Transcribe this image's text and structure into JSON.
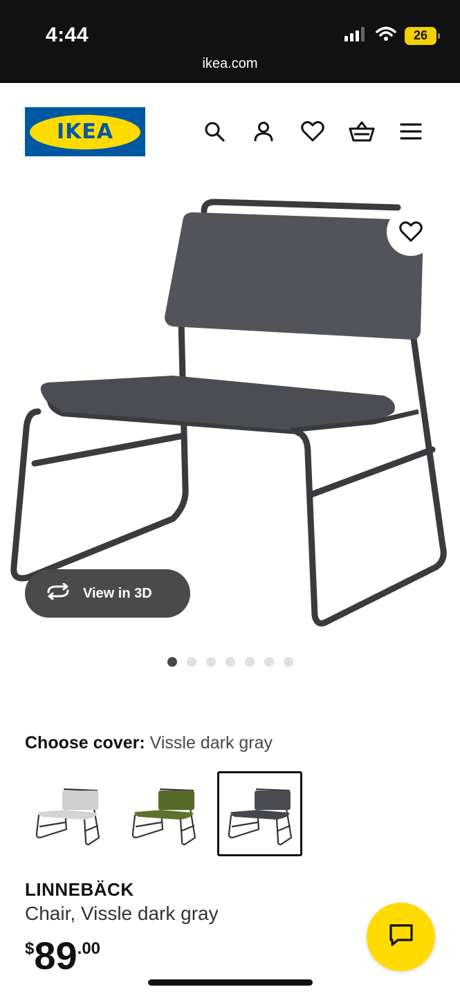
{
  "status_bar": {
    "time": "4:44",
    "battery": "26",
    "url": "ikea.com"
  },
  "header": {
    "logo_text": "IKEA",
    "icons": [
      "search-icon",
      "account-icon",
      "heart-icon",
      "basket-icon",
      "menu-icon"
    ]
  },
  "gallery": {
    "view_3d_label": "View in 3D",
    "dots_count": 7,
    "active_dot": 1
  },
  "cover": {
    "label": "Choose cover:",
    "selected_value": "Vissle dark gray",
    "swatches": [
      {
        "name": "light gray",
        "color": "#c9c9c9",
        "selected": false
      },
      {
        "name": "green",
        "color": "#566b2a",
        "selected": false
      },
      {
        "name": "dark gray",
        "color": "#4b4c52",
        "selected": true
      }
    ]
  },
  "product": {
    "name": "LINNEBÄCK",
    "description": "Chair, Vissle dark gray",
    "price_currency": "$",
    "price_int": "89",
    "price_dec": ".00"
  },
  "colors": {
    "brand_blue": "#0058a3",
    "brand_yellow": "#ffdb00"
  }
}
